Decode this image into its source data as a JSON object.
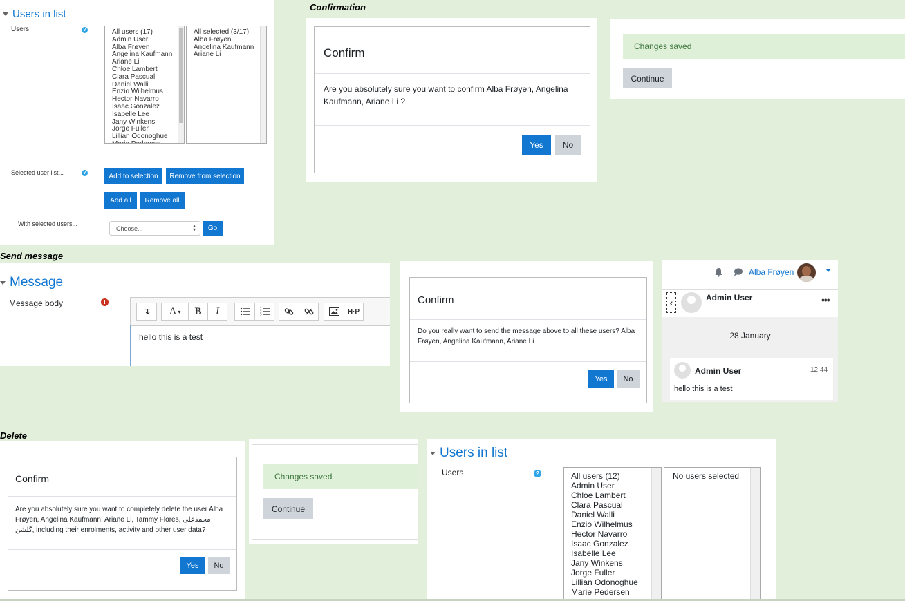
{
  "top_left": {
    "legend": "Users in list",
    "users_label": "Users",
    "available_users": [
      "All users (17)",
      "Admin User",
      "Alba Frøyen",
      "Angelina Kaufmann",
      "Ariane Li",
      "Chloe Lambert",
      "Clara Pascual",
      "Daniel Walli",
      "Enzio Wilhelmus",
      "Hector Navarro",
      "Isaac Gonzalez",
      "Isabelle Lee",
      "Jany Winkens",
      "Jorge Fuller",
      "Lillian Odonoghue",
      "Marie Pedersen"
    ],
    "selected_users": [
      "All selected (3/17)",
      "Alba Frøyen",
      "Angelina Kaufmann",
      "Ariane Li"
    ],
    "selected_list_label": "Selected user list...",
    "add_to_selection": "Add to selection",
    "remove_from_selection": "Remove from selection",
    "add_all": "Add all",
    "remove_all": "Remove all",
    "with_selected_label": "With selected users...",
    "choose_value": "Choose...",
    "go": "Go"
  },
  "confirmation_section": {
    "label": "Confirmation",
    "title": "Confirm",
    "body": "Are you absolutely sure you want to confirm Alba Frøyen, Angelina Kaufmann, Ariane Li ?",
    "yes": "Yes",
    "no": "No",
    "changes_saved": "Changes saved",
    "continue": "Continue"
  },
  "send_message_section": {
    "label": "Send message",
    "legend": "Message",
    "body_label": "Message body",
    "editor_text": "hello this is a test",
    "confirm_title": "Confirm",
    "confirm_body": "Do you really want to send the message above to all these users? Alba Frøyen, Angelina Kaufmann, Ariane Li",
    "yes": "Yes",
    "no": "No"
  },
  "messaging_drawer": {
    "user_name": "Alba Frøyen",
    "conversation_with": "Admin User",
    "date": "28 January",
    "message_sender": "Admin User",
    "message_time": "12:44",
    "message_text": "hello this is a test"
  },
  "delete_section": {
    "label": "Delete",
    "title": "Confirm",
    "body": "Are you absolutely sure you want to completely delete the user Alba Frøyen, Angelina Kaufmann, Ariane Li, Tammy Flores, محمدعلی گلشن, including their enrolments, activity and other user data?",
    "yes": "Yes",
    "no": "No",
    "changes_saved": "Changes saved",
    "continue": "Continue"
  },
  "bottom_right": {
    "legend": "Users in list",
    "users_label": "Users",
    "available_users": [
      "All users (12)",
      "Admin User",
      "Chloe Lambert",
      "Clara Pascual",
      "Daniel Walli",
      "Enzio Wilhelmus",
      "Hector Navarro",
      "Isaac Gonzalez",
      "Isabelle Lee",
      "Jany Winkens",
      "Jorge Fuller",
      "Lillian Odonoghue",
      "Marie Pedersen"
    ],
    "selected_placeholder": "No users selected"
  },
  "colors": {
    "primary": "#1177d1",
    "secondary": "#ced4da",
    "success_bg": "#dff0d8",
    "success_text": "#3c763d",
    "page_bg": "#e2efda"
  }
}
